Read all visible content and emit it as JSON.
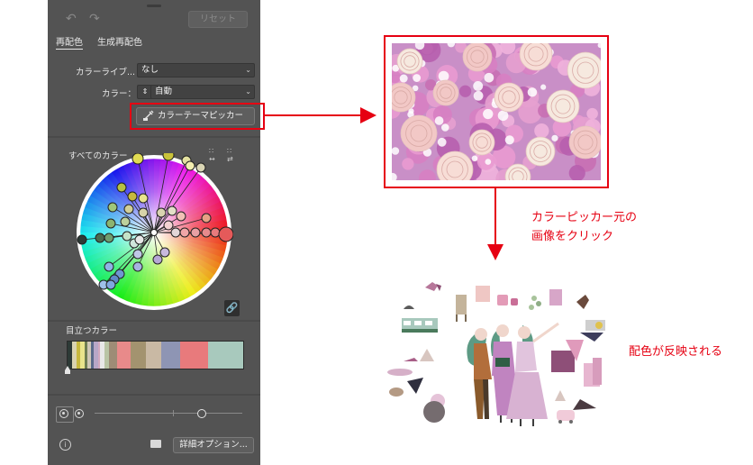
{
  "panel": {
    "reset_label": "リセット",
    "tabs": [
      {
        "label": "再配色",
        "active": true
      },
      {
        "label": "生成再配色",
        "active": false
      }
    ],
    "library_label": "カラーライブ...",
    "library_value": "なし",
    "colors_label": "カラー：",
    "colors_value": "自動",
    "picker_button_label": "カラーテーマピッカー",
    "all_colors_label": "すべてのカラー",
    "prominent_label": "目立つカラー",
    "advanced_button_label": "詳細オプション...",
    "prominent_colors": [
      "#2d3a36",
      "#d9d3b0",
      "#c7b93e",
      "#e9e48c",
      "#6f7e52",
      "#cfc7b5",
      "#5b6b8a",
      "#b8a7c7",
      "#d2aac0",
      "#e8e8e8",
      "#b9c4a5",
      "#9e8c76",
      "#e88a8a",
      "#a3936f",
      "#c9b9a4",
      "#8e95b4",
      "#e87a7c",
      "#a8c9bd"
    ],
    "prominent_colors_share": [
      2,
      2,
      2,
      2,
      1,
      2,
      1,
      2,
      1,
      2,
      2,
      4,
      6,
      7,
      7,
      9,
      13,
      16
    ]
  },
  "annotations": {
    "step1": "カラーピッカー元の",
    "step2": "画像をクリック",
    "result": "配色が反映される"
  },
  "colors": {
    "highlight_red": "#e60012",
    "panel_bg": "#535353"
  }
}
